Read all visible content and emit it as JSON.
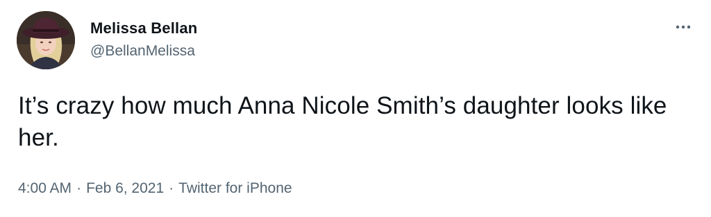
{
  "tweet": {
    "author": {
      "display_name": "Melissa Bellan",
      "handle": "@BellanMelissa",
      "avatar_icon": "profile-photo-woman-hat"
    },
    "more_icon": "more-dots-icon",
    "text": "It’s crazy how much Anna Nicole Smith’s daughter looks like her.",
    "meta": {
      "time": "4:00 AM",
      "date": "Feb 6, 2021",
      "separator": "·",
      "source": "Twitter for iPhone"
    }
  },
  "colors": {
    "primary_text": "#0f1419",
    "secondary_text": "#536471",
    "background": "#ffffff"
  }
}
